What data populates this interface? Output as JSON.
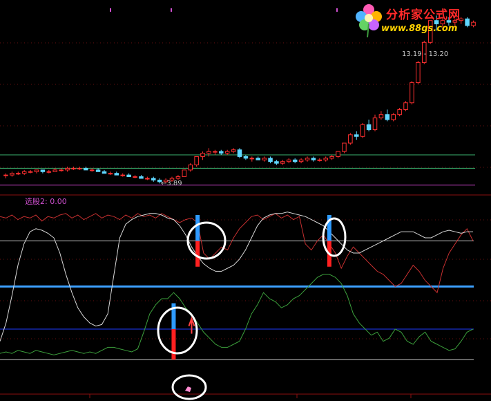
{
  "watermark": {
    "name": "分析家公式网",
    "url": "www.88gs.com"
  },
  "chart_data": [
    {
      "type": "candlestick",
      "annotations": {
        "time_range": "13.19 - 13.20",
        "low_price_label": "3.89"
      },
      "candles": [
        {
          "o": 3.94,
          "h": 3.95,
          "l": 3.92,
          "c": 3.94
        },
        {
          "o": 3.94,
          "h": 3.96,
          "l": 3.93,
          "c": 3.95
        },
        {
          "o": 3.95,
          "h": 3.96,
          "l": 3.94,
          "c": 3.95
        },
        {
          "o": 3.95,
          "h": 3.97,
          "l": 3.94,
          "c": 3.96
        },
        {
          "o": 3.96,
          "h": 3.97,
          "l": 3.95,
          "c": 3.96
        },
        {
          "o": 3.96,
          "h": 3.97,
          "l": 3.95,
          "c": 3.97
        },
        {
          "o": 3.97,
          "h": 3.97,
          "l": 3.95,
          "c": 3.96
        },
        {
          "o": 3.96,
          "h": 3.97,
          "l": 3.95,
          "c": 3.96
        },
        {
          "o": 3.96,
          "h": 3.98,
          "l": 3.96,
          "c": 3.97
        },
        {
          "o": 3.97,
          "h": 3.98,
          "l": 3.96,
          "c": 3.97
        },
        {
          "o": 3.97,
          "h": 3.99,
          "l": 3.96,
          "c": 3.98
        },
        {
          "o": 3.98,
          "h": 3.99,
          "l": 3.97,
          "c": 3.98
        },
        {
          "o": 3.98,
          "h": 3.99,
          "l": 3.97,
          "c": 3.98
        },
        {
          "o": 3.98,
          "h": 3.99,
          "l": 3.97,
          "c": 3.97
        },
        {
          "o": 3.97,
          "h": 3.98,
          "l": 3.96,
          "c": 3.97
        },
        {
          "o": 3.97,
          "h": 3.98,
          "l": 3.96,
          "c": 3.96
        },
        {
          "o": 3.96,
          "h": 3.97,
          "l": 3.95,
          "c": 3.95
        },
        {
          "o": 3.95,
          "h": 3.96,
          "l": 3.94,
          "c": 3.95
        },
        {
          "o": 3.95,
          "h": 3.96,
          "l": 3.94,
          "c": 3.94
        },
        {
          "o": 3.94,
          "h": 3.95,
          "l": 3.93,
          "c": 3.94
        },
        {
          "o": 3.94,
          "h": 3.95,
          "l": 3.93,
          "c": 3.93
        },
        {
          "o": 3.93,
          "h": 3.94,
          "l": 3.92,
          "c": 3.93
        },
        {
          "o": 3.93,
          "h": 3.94,
          "l": 3.92,
          "c": 3.92
        },
        {
          "o": 3.92,
          "h": 3.93,
          "l": 3.91,
          "c": 3.92
        },
        {
          "o": 3.92,
          "h": 3.93,
          "l": 3.9,
          "c": 3.91
        },
        {
          "o": 3.91,
          "h": 3.92,
          "l": 3.89,
          "c": 3.9
        },
        {
          "o": 3.9,
          "h": 3.92,
          "l": 3.89,
          "c": 3.91
        },
        {
          "o": 3.91,
          "h": 3.93,
          "l": 3.9,
          "c": 3.92
        },
        {
          "o": 3.92,
          "h": 3.94,
          "l": 3.91,
          "c": 3.93
        },
        {
          "o": 3.93,
          "h": 3.97,
          "l": 3.93,
          "c": 3.97
        },
        {
          "o": 3.97,
          "h": 4.01,
          "l": 3.96,
          "c": 4.0
        },
        {
          "o": 4.0,
          "h": 4.05,
          "l": 3.99,
          "c": 4.05
        },
        {
          "o": 4.05,
          "h": 4.08,
          "l": 4.03,
          "c": 4.07
        },
        {
          "o": 4.07,
          "h": 4.1,
          "l": 4.05,
          "c": 4.08
        },
        {
          "o": 4.08,
          "h": 4.09,
          "l": 4.06,
          "c": 4.08
        },
        {
          "o": 4.08,
          "h": 4.09,
          "l": 4.06,
          "c": 4.07
        },
        {
          "o": 4.07,
          "h": 4.09,
          "l": 4.06,
          "c": 4.08
        },
        {
          "o": 4.08,
          "h": 4.1,
          "l": 4.07,
          "c": 4.09
        },
        {
          "o": 4.09,
          "h": 4.1,
          "l": 4.04,
          "c": 4.05
        },
        {
          "o": 4.05,
          "h": 4.06,
          "l": 4.03,
          "c": 4.04
        },
        {
          "o": 4.04,
          "h": 4.05,
          "l": 4.02,
          "c": 4.04
        },
        {
          "o": 4.04,
          "h": 4.05,
          "l": 4.03,
          "c": 4.03
        },
        {
          "o": 4.03,
          "h": 4.05,
          "l": 4.02,
          "c": 4.04
        },
        {
          "o": 4.04,
          "h": 4.05,
          "l": 4.01,
          "c": 4.02
        },
        {
          "o": 4.02,
          "h": 4.03,
          "l": 4.0,
          "c": 4.01
        },
        {
          "o": 4.01,
          "h": 4.03,
          "l": 4.0,
          "c": 4.02
        },
        {
          "o": 4.02,
          "h": 4.04,
          "l": 4.01,
          "c": 4.03
        },
        {
          "o": 4.03,
          "h": 4.04,
          "l": 4.01,
          "c": 4.02
        },
        {
          "o": 4.02,
          "h": 4.04,
          "l": 4.01,
          "c": 4.03
        },
        {
          "o": 4.03,
          "h": 4.05,
          "l": 4.02,
          "c": 4.04
        },
        {
          "o": 4.04,
          "h": 4.05,
          "l": 4.02,
          "c": 4.03
        },
        {
          "o": 4.03,
          "h": 4.04,
          "l": 4.02,
          "c": 4.03
        },
        {
          "o": 4.03,
          "h": 4.05,
          "l": 4.02,
          "c": 4.04
        },
        {
          "o": 4.04,
          "h": 4.06,
          "l": 4.03,
          "c": 4.05
        },
        {
          "o": 4.05,
          "h": 4.08,
          "l": 4.04,
          "c": 4.08
        },
        {
          "o": 4.08,
          "h": 4.13,
          "l": 4.07,
          "c": 4.13
        },
        {
          "o": 4.13,
          "h": 4.19,
          "l": 4.12,
          "c": 4.18
        },
        {
          "o": 4.18,
          "h": 4.2,
          "l": 4.15,
          "c": 4.17
        },
        {
          "o": 4.17,
          "h": 4.25,
          "l": 4.16,
          "c": 4.24
        },
        {
          "o": 4.24,
          "h": 4.27,
          "l": 4.2,
          "c": 4.21
        },
        {
          "o": 4.21,
          "h": 4.3,
          "l": 4.2,
          "c": 4.28
        },
        {
          "o": 4.28,
          "h": 4.32,
          "l": 4.27,
          "c": 4.3
        },
        {
          "o": 4.3,
          "h": 4.33,
          "l": 4.26,
          "c": 4.27
        },
        {
          "o": 4.27,
          "h": 4.31,
          "l": 4.26,
          "c": 4.3
        },
        {
          "o": 4.3,
          "h": 4.34,
          "l": 4.29,
          "c": 4.33
        },
        {
          "o": 4.33,
          "h": 4.38,
          "l": 4.32,
          "c": 4.37
        },
        {
          "o": 4.37,
          "h": 4.5,
          "l": 4.36,
          "c": 4.49
        },
        {
          "o": 4.49,
          "h": 4.62,
          "l": 4.48,
          "c": 4.61
        },
        {
          "o": 4.61,
          "h": 4.74,
          "l": 4.6,
          "c": 4.73
        },
        {
          "o": 4.73,
          "h": 4.86,
          "l": 4.72,
          "c": 4.86
        },
        {
          "o": 4.86,
          "h": 4.89,
          "l": 4.8,
          "c": 4.84
        },
        {
          "o": 4.84,
          "h": 4.88,
          "l": 4.82,
          "c": 4.86
        },
        {
          "o": 4.86,
          "h": 4.88,
          "l": 4.83,
          "c": 4.85
        },
        {
          "o": 4.85,
          "h": 4.87,
          "l": 4.82,
          "c": 4.86
        },
        {
          "o": 4.86,
          "h": 4.88,
          "l": 4.84,
          "c": 4.87
        },
        {
          "o": 4.87,
          "h": 4.88,
          "l": 4.82,
          "c": 4.83
        },
        {
          "o": 4.83,
          "h": 4.86,
          "l": 4.82,
          "c": 4.85
        }
      ],
      "ylim": [
        3.85,
        4.9
      ],
      "hlines": [
        {
          "value": 4.06,
          "color": "#3cb371"
        },
        {
          "value": 3.98,
          "color": "#3cb371"
        },
        {
          "value": 3.88,
          "color": "#c040c0"
        }
      ],
      "colors": {
        "up": "#ff3030",
        "down": "#5fd7ff",
        "bg": "#000000"
      }
    },
    {
      "type": "line",
      "title": "选股2: 0.00",
      "ylim": [
        0,
        100
      ],
      "x": [
        0,
        1,
        2,
        3,
        4,
        5,
        6,
        7,
        8,
        9,
        10,
        11,
        12,
        13,
        14,
        15,
        16,
        17,
        18,
        19,
        20,
        21,
        22,
        23,
        24,
        25,
        26,
        27,
        28,
        29,
        30,
        31,
        32,
        33,
        34,
        35,
        36,
        37,
        38,
        39,
        40,
        41,
        42,
        43,
        44,
        45,
        46,
        47,
        48,
        49,
        50,
        51,
        52,
        53,
        54,
        55,
        56,
        57,
        58,
        59,
        60,
        61,
        62,
        63,
        64,
        65,
        66,
        67,
        68,
        69,
        70,
        71,
        72,
        73,
        74,
        75,
        76,
        77,
        78,
        79
      ],
      "series": [
        {
          "color": "#c83030",
          "values": [
            94,
            93,
            95,
            92,
            94,
            93,
            95,
            91,
            94,
            93,
            95,
            96,
            93,
            95,
            92,
            94,
            96,
            93,
            95,
            94,
            92,
            95,
            93,
            96,
            94,
            95,
            93,
            96,
            94,
            92,
            90,
            92,
            93,
            90,
            70,
            66,
            70,
            74,
            72,
            80,
            86,
            90,
            94,
            95,
            92,
            94,
            96,
            93,
            95,
            92,
            94,
            76,
            72,
            78,
            82,
            76,
            70,
            60,
            68,
            74,
            70,
            66,
            62,
            58,
            56,
            52,
            48,
            50,
            56,
            62,
            58,
            52,
            48,
            44,
            60,
            70,
            76,
            82,
            86,
            78
          ]
        },
        {
          "color": "#d8d8d8",
          "values": [
            12,
            24,
            42,
            62,
            76,
            84,
            86,
            85,
            83,
            80,
            70,
            56,
            44,
            34,
            28,
            24,
            22,
            23,
            30,
            55,
            80,
            89,
            92,
            94,
            95,
            96,
            96,
            95,
            93,
            92,
            88,
            82,
            74,
            68,
            63,
            60,
            58,
            58,
            60,
            62,
            66,
            72,
            80,
            88,
            93,
            95,
            96,
            96,
            97,
            96,
            95,
            94,
            92,
            90,
            88,
            84,
            80,
            76,
            72,
            70,
            70,
            72,
            74,
            76,
            78,
            80,
            82,
            84,
            84,
            84,
            82,
            80,
            80,
            82,
            84,
            85,
            84,
            83,
            84,
            84
          ]
        },
        {
          "color": "#3ca03c",
          "values": [
            4,
            5,
            4,
            6,
            5,
            4,
            6,
            5,
            4,
            3,
            4,
            5,
            6,
            5,
            4,
            5,
            4,
            6,
            8,
            8,
            7,
            6,
            5,
            7,
            18,
            30,
            36,
            40,
            40,
            44,
            40,
            34,
            30,
            24,
            18,
            14,
            10,
            8,
            8,
            10,
            12,
            20,
            30,
            36,
            44,
            40,
            38,
            34,
            36,
            40,
            42,
            46,
            50,
            54,
            56,
            56,
            54,
            50,
            42,
            30,
            24,
            20,
            16,
            18,
            12,
            14,
            20,
            18,
            12,
            10,
            15,
            18,
            12,
            10,
            8,
            6,
            7,
            12,
            18,
            20
          ]
        }
      ],
      "hlines": [
        {
          "value": 78,
          "color": "#c8c8c8"
        },
        {
          "value": 48,
          "color": "#3ca0ff"
        },
        {
          "value": 20,
          "color": "#1e3cff"
        },
        {
          "value": 0,
          "color": "#c8c8c8"
        }
      ],
      "markers": [
        {
          "x": 33,
          "blue": [
            78,
            95
          ],
          "red": [
            78,
            61
          ]
        },
        {
          "x": 55,
          "blue": [
            78,
            95
          ],
          "red": [
            78,
            61
          ]
        },
        {
          "x": 29,
          "blue": [
            20,
            37
          ],
          "red": [
            20,
            0
          ]
        }
      ]
    }
  ]
}
